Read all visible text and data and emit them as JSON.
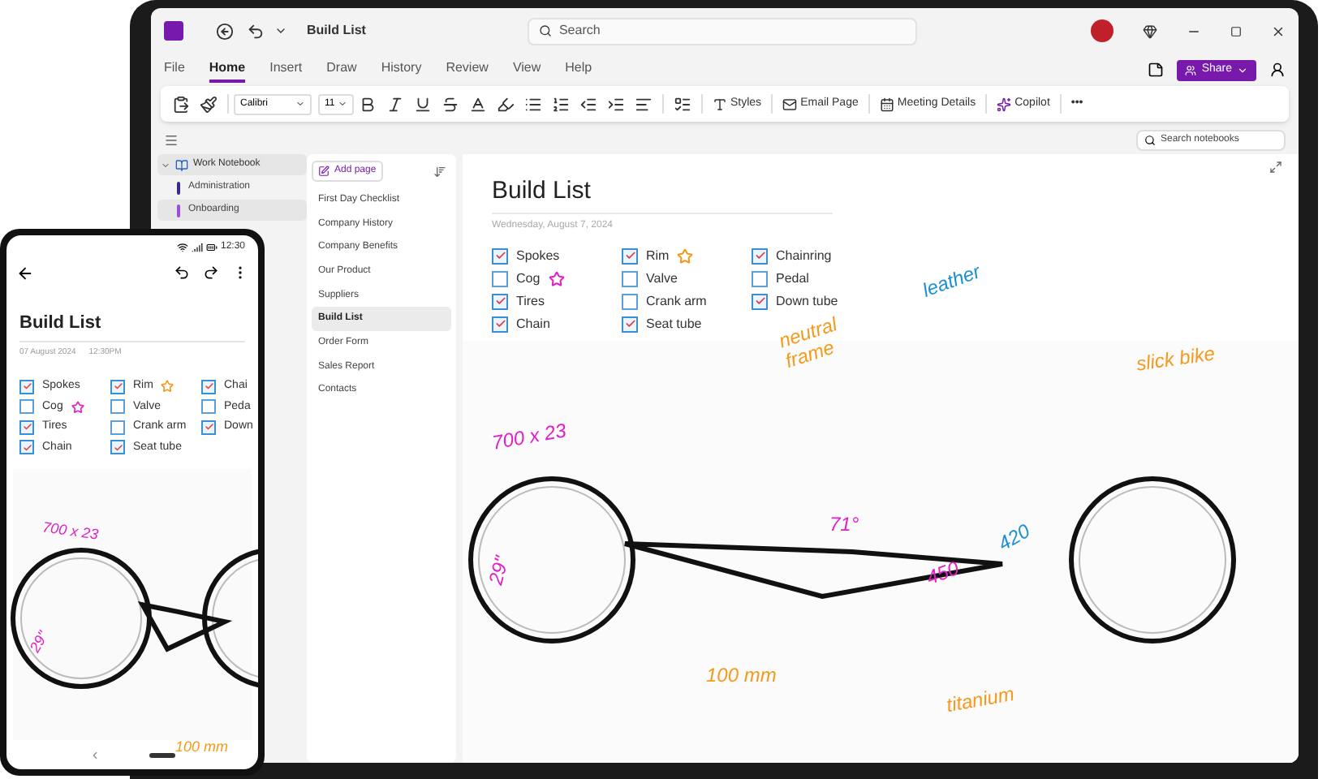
{
  "window": {
    "title": "Build List",
    "search_placeholder": "Search"
  },
  "tabs": [
    {
      "label": "File",
      "selected": false
    },
    {
      "label": "Home",
      "selected": true
    },
    {
      "label": "Insert",
      "selected": false
    },
    {
      "label": "Draw",
      "selected": false
    },
    {
      "label": "History",
      "selected": false
    },
    {
      "label": "Review",
      "selected": false
    },
    {
      "label": "View",
      "selected": false
    },
    {
      "label": "Help",
      "selected": false
    }
  ],
  "share_button": "Share",
  "ribbon": {
    "font": "Calibri",
    "size": "11",
    "styles": "Styles",
    "email_page": "Email Page",
    "meeting_details": "Meeting Details",
    "copilot": "Copilot",
    "more": "•••"
  },
  "search_notebooks": {
    "placeholder": "Search notebooks"
  },
  "notebook": {
    "name": "Work Notebook",
    "expanded": true,
    "sections": [
      {
        "label": "Administration",
        "color": "#3b2a8a",
        "selected": false
      },
      {
        "label": "Onboarding",
        "color": "#9b4fd6",
        "selected": true
      }
    ]
  },
  "add_page": "Add page",
  "pages": [
    {
      "label": "First Day Checklist",
      "selected": false
    },
    {
      "label": "Company History",
      "selected": false
    },
    {
      "label": "Company Benefits",
      "selected": false
    },
    {
      "label": "Our Product",
      "selected": false
    },
    {
      "label": "Suppliers",
      "selected": false
    },
    {
      "label": "Build List",
      "selected": true
    },
    {
      "label": "Order Form",
      "selected": false
    },
    {
      "label": "Sales Report",
      "selected": false
    },
    {
      "label": "Contacts",
      "selected": false
    }
  ],
  "page": {
    "title": "Build List",
    "date": "Wednesday, August 7, 2024",
    "checklist": [
      [
        {
          "label": "Spokes",
          "checked": true
        },
        {
          "label": "Cog",
          "checked": false,
          "color": "#e020c8"
        },
        {
          "label": "Tires",
          "checked": true
        },
        {
          "label": "Chain",
          "checked": true
        }
      ],
      [
        {
          "label": "Rim",
          "checked": true,
          "color": "#f59a1c"
        },
        {
          "label": "Valve",
          "checked": false
        },
        {
          "label": "Crank arm",
          "checked": false
        },
        {
          "label": "Seat tube",
          "checked": true
        }
      ],
      [
        {
          "label": "Chainring",
          "checked": true
        },
        {
          "label": "Pedal",
          "checked": false
        },
        {
          "label": "Down tube",
          "checked": true
        }
      ]
    ],
    "ink": [
      {
        "text": "neutral frame",
        "color": "#f59a1c"
      },
      {
        "text": "leather",
        "color": "#1a8fd8"
      },
      {
        "text": "slick bike",
        "color": "#f59a1c"
      },
      {
        "text": "700 x 23",
        "color": "#e020c8"
      },
      {
        "text": "29\"",
        "color": "#e020c8"
      },
      {
        "text": "71°",
        "color": "#e020c8"
      },
      {
        "text": "450",
        "color": "#e020c8"
      },
      {
        "text": "420",
        "color": "#1a8fd8"
      },
      {
        "text": "100 mm",
        "color": "#f59a1c"
      },
      {
        "text": "titanium",
        "color": "#f59a1c"
      }
    ]
  },
  "phone": {
    "time": "12:30",
    "title": "Build List",
    "date": "07 August 2024",
    "time_stamp": "12:30PM",
    "checklist": [
      [
        {
          "label": "Spokes",
          "checked": true
        },
        {
          "label": "Cog",
          "checked": false,
          "color": "#e020c8"
        },
        {
          "label": "Tires",
          "checked": true
        },
        {
          "label": "Chain",
          "checked": true
        }
      ],
      [
        {
          "label": "Rim",
          "checked": true,
          "color": "#f59a1c"
        },
        {
          "label": "Valve",
          "checked": false
        },
        {
          "label": "Crank arm",
          "checked": false
        },
        {
          "label": "Seat tube",
          "checked": true
        }
      ],
      [
        {
          "label": "Chai",
          "checked": true
        },
        {
          "label": "Peda",
          "checked": false
        },
        {
          "label": "Down",
          "checked": true
        }
      ]
    ],
    "ink": [
      {
        "text": "700 x 23",
        "color": "#e020c8"
      },
      {
        "text": "29\"",
        "color": "#e020c8"
      },
      {
        "text": "100 mm",
        "color": "#f59a1c"
      }
    ]
  }
}
